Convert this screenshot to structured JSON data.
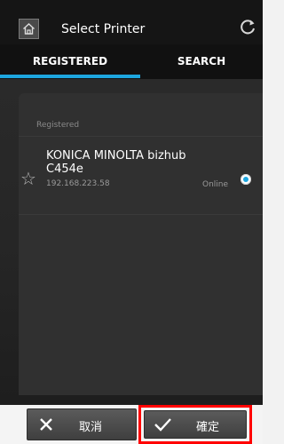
{
  "header": {
    "title": "Select Printer"
  },
  "tabs": [
    {
      "label": "REGISTERED",
      "active": true
    },
    {
      "label": "SEARCH",
      "active": false
    }
  ],
  "registered": {
    "section_label": "Registered",
    "printers": [
      {
        "name": "KONICA MINOLTA bizhub C454e",
        "ip": "192.168.223.58",
        "status": "Online",
        "selected": true
      }
    ]
  },
  "buttons": {
    "cancel_label": "取消",
    "confirm_label": "確定"
  },
  "colors": {
    "accent": "#1da6df",
    "highlight_frame": "#ff0000"
  },
  "icons": {
    "home": "home-icon",
    "refresh": "refresh-icon",
    "favorite": "star-outline-icon",
    "cancel": "x-icon",
    "confirm": "checkmark-icon"
  }
}
